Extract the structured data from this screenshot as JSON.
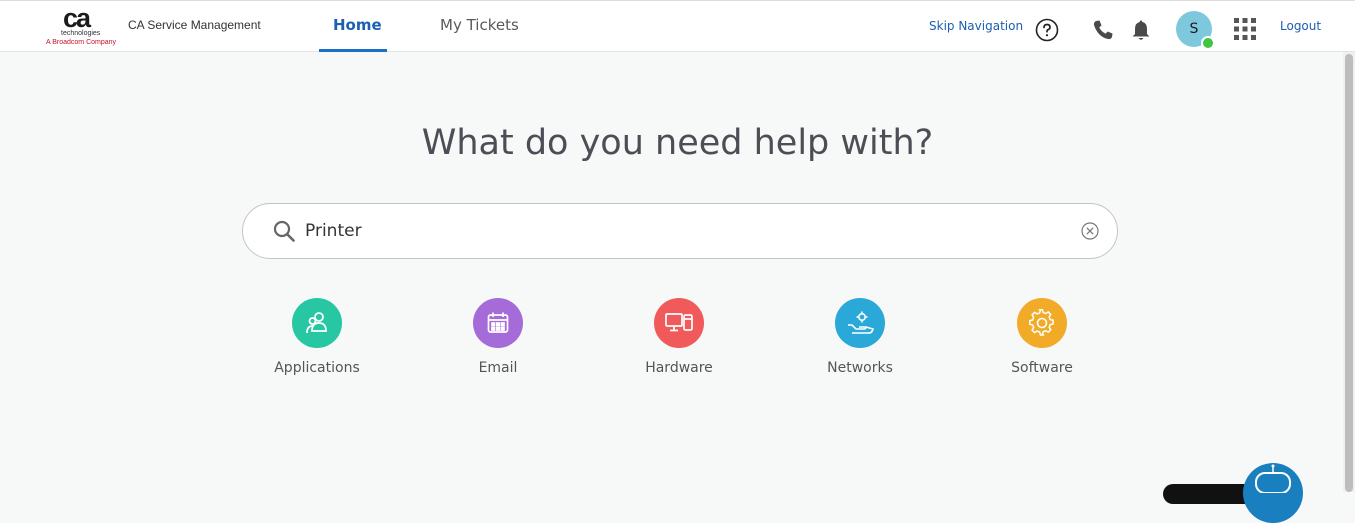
{
  "header": {
    "logo": {
      "mark": "ca",
      "tagline": "technologies",
      "company": "A Broadcom Company"
    },
    "app_title": "CA Service Management",
    "tabs": [
      {
        "label": "Home",
        "active": true
      },
      {
        "label": "My Tickets",
        "active": false
      }
    ],
    "skip_navigation": "Skip Navigation",
    "icons": [
      "help-icon",
      "phone-icon",
      "bell-icon",
      "apps-grid-icon"
    ],
    "avatar_initial": "S",
    "presence_status_color": "#3fc53f",
    "logout": "Logout"
  },
  "main": {
    "headline": "What do you need help with?",
    "search": {
      "value": "Printer",
      "placeholder": ""
    },
    "categories": [
      {
        "label": "Applications",
        "icon": "users-icon",
        "color": "#27c7a4"
      },
      {
        "label": "Email",
        "icon": "calendar-icon",
        "color": "#a56bd9"
      },
      {
        "label": "Hardware",
        "icon": "devices-icon",
        "color": "#f05a5a"
      },
      {
        "label": "Networks",
        "icon": "network-hand-icon",
        "color": "#2aa8d8"
      },
      {
        "label": "Software",
        "icon": "gear-icon",
        "color": "#f2ab28"
      }
    ]
  },
  "colors": {
    "accent": "#1a5fb4",
    "background": "#f7f8f8"
  }
}
